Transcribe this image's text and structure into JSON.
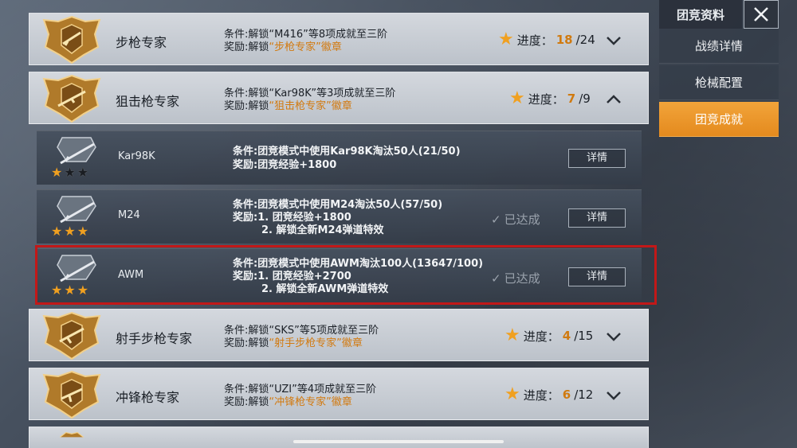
{
  "header": {
    "title": "团竞资料"
  },
  "nav": [
    {
      "label": "战绩详情",
      "active": false
    },
    {
      "label": "枪械配置",
      "active": false
    },
    {
      "label": "团竞成就",
      "active": true
    }
  ],
  "categories": [
    {
      "name": "步枪专家",
      "cond_prefix": "条件:解锁“M416”等8项成就至三阶",
      "reward_prefix": "奖励:解锁",
      "reward_highlight": "“步枪专家”徽章",
      "progress_label": "进度：",
      "progress_value": "18",
      "progress_total": "/24",
      "expanded": false
    },
    {
      "name": "狙击枪专家",
      "cond_prefix": "条件:解锁“Kar98K”等3项成就至三阶",
      "reward_prefix": "奖励:解锁",
      "reward_highlight": "“狙击枪专家”徽章",
      "progress_label": "进度：",
      "progress_value": "7",
      "progress_total": "/9",
      "expanded": true
    },
    {
      "name": "射手步枪专家",
      "cond_prefix": "条件:解锁“SKS”等5项成就至三阶",
      "reward_prefix": "奖励:解锁",
      "reward_highlight": "“射手步枪专家”徽章",
      "progress_label": "进度：",
      "progress_value": "4",
      "progress_total": "/15",
      "expanded": false
    },
    {
      "name": "冲锋枪专家",
      "cond_prefix": "条件:解锁“UZI”等4项成就至三阶",
      "reward_prefix": "奖励:解锁",
      "reward_highlight": "“冲锋枪专家”徽章",
      "progress_label": "进度：",
      "progress_value": "6",
      "progress_total": "/12",
      "expanded": false
    }
  ],
  "sub_items": [
    {
      "name": "Kar98K",
      "stars": 1,
      "condition": "条件:团竞模式中使用Kar98K淘汰50人(21/50)",
      "reward1": "奖励:团竞经验+1800",
      "reward2": "",
      "achieved": "",
      "detail": "详情"
    },
    {
      "name": "M24",
      "stars": 3,
      "condition": "条件:团竞模式中使用M24淘汰50人(57/50)",
      "reward1": "奖励:1. 团竞经验+1800",
      "reward2": "2. 解锁全新M24弹道特效",
      "achieved": "已达成",
      "detail": "详情"
    },
    {
      "name": "AWM",
      "stars": 3,
      "condition": "条件:团竞模式中使用AWM淘汰100人(13647/100)",
      "reward1": "奖励:1. 团竞经验+2700",
      "reward2": "2. 解锁全新AWM弹道特效",
      "achieved": "已达成",
      "detail": "详情"
    }
  ],
  "colors": {
    "accent_orange": "#e48a1e",
    "highlight_red": "#c21818",
    "star_gold": "#f0a020"
  }
}
